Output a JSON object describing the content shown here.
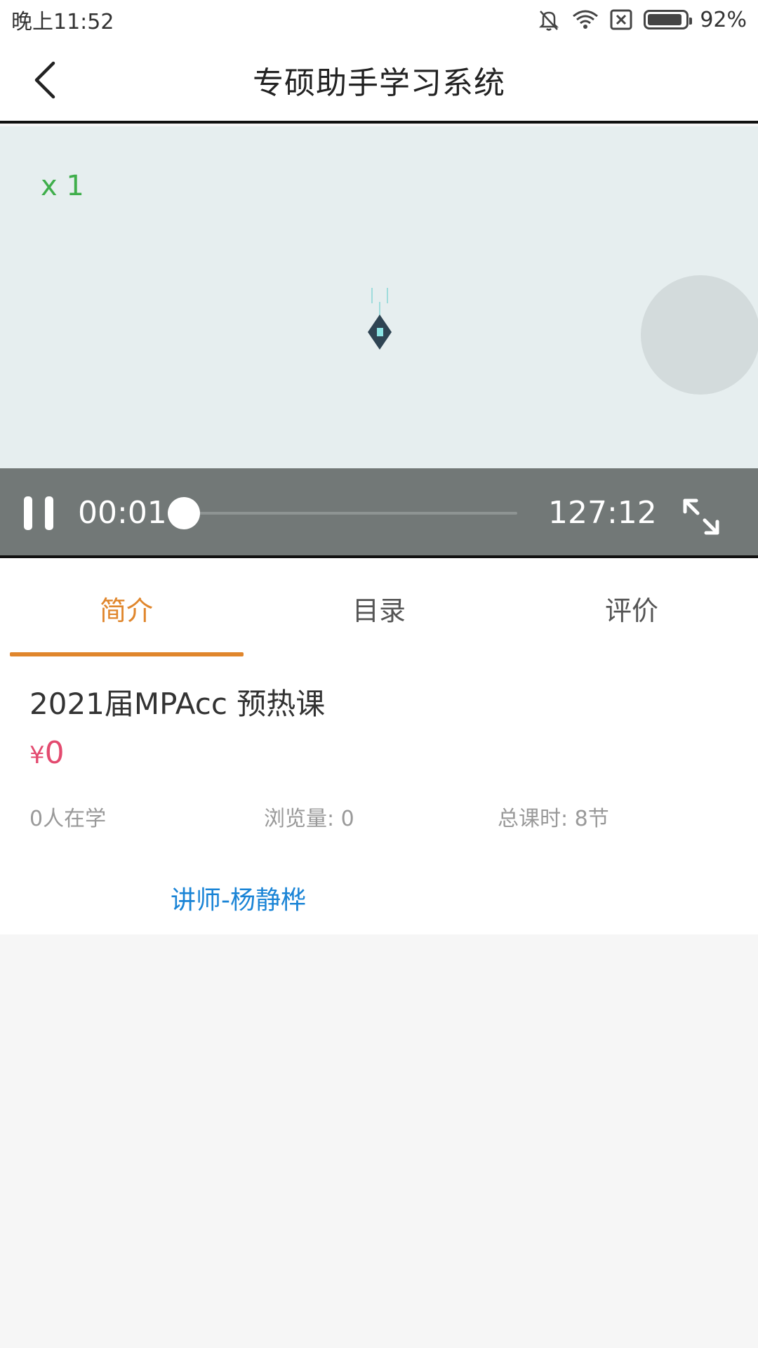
{
  "status_bar": {
    "time": "晚上11:52",
    "battery_percent": "92%",
    "battery_level": 0.92,
    "icons": [
      "bell-off-icon",
      "wifi-icon",
      "sim-x-icon",
      "battery-icon"
    ]
  },
  "app_bar": {
    "title": "专硕助手学习系统",
    "back_icon": "chevron-left-icon"
  },
  "player": {
    "speed": "x 1",
    "current_time": "00:01",
    "total_time": "127:12",
    "progress": 0.0001,
    "state": "playing",
    "icons": [
      "pause-icon",
      "fullscreen-icon"
    ]
  },
  "tabs": [
    {
      "label": "简介",
      "active": true
    },
    {
      "label": "目录",
      "active": false
    },
    {
      "label": "评价",
      "active": false
    }
  ],
  "course": {
    "title": "2021届MPAcc 预热课",
    "price_symbol": "¥",
    "price_value": "0",
    "learners": "0人在学",
    "views": "浏览量: 0",
    "total_lessons": "总课时: 8节",
    "teacher": "讲师-杨静桦"
  },
  "colors": {
    "accent": "#e0862c",
    "price": "#e34a6f",
    "link": "#1a84d6",
    "speed": "#3fae4b",
    "controls_bg": "#727877"
  }
}
